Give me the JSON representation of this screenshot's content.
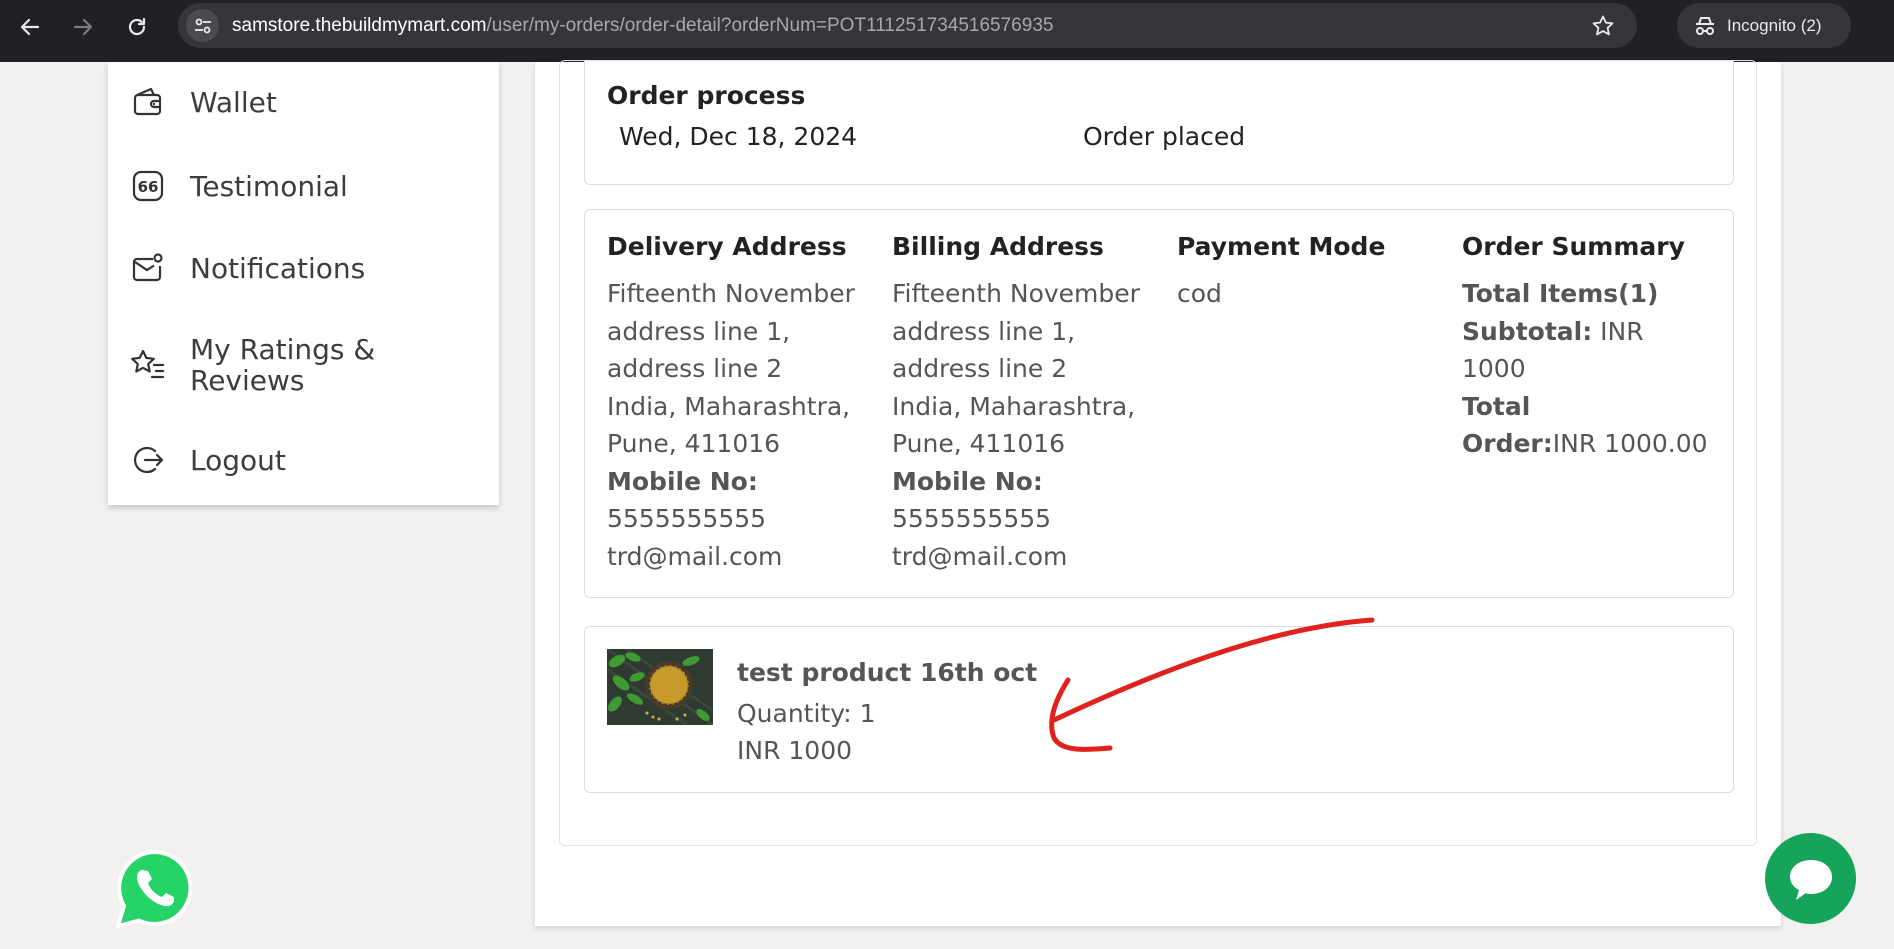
{
  "browser": {
    "url_host": "samstore.thebuildmymart.com",
    "url_path": "/user/my-orders/order-detail?orderNum=POT111251734516576935",
    "incognito_label": "Incognito (2)"
  },
  "sidebar": {
    "items": [
      {
        "label": "Wallet",
        "icon": "wallet-icon"
      },
      {
        "label": "Testimonial",
        "icon": "quote-icon"
      },
      {
        "label": "Notifications",
        "icon": "mail-notification-icon"
      },
      {
        "label": "My Ratings & Reviews",
        "icon": "star-rating-icon"
      },
      {
        "label": "Logout",
        "icon": "logout-icon"
      }
    ]
  },
  "order_process": {
    "title": "Order process",
    "date": "Wed, Dec 18, 2024",
    "status": "Order placed"
  },
  "delivery_address": {
    "title": "Delivery Address",
    "line1": "Fifteenth November",
    "line2": "address line 1,",
    "line3": "address line 2",
    "line4": "India, Maharashtra,",
    "line5": "Pune, 411016",
    "mobile_label": "Mobile No:",
    "mobile": "5555555555",
    "email": "trd@mail.com"
  },
  "billing_address": {
    "title": "Billing Address",
    "line1": "Fifteenth November",
    "line2": "address line 1,",
    "line3": "address line 2",
    "line4": "India, Maharashtra,",
    "line5": "Pune, 411016",
    "mobile_label": "Mobile No:",
    "mobile": "5555555555",
    "email": "trd@mail.com"
  },
  "payment": {
    "title": "Payment Mode",
    "mode": "cod"
  },
  "order_summary": {
    "title": "Order Summary",
    "total_items": "Total Items(1)",
    "subtotal_label": "Subtotal:",
    "subtotal_value": " INR 1000",
    "total_label_1": "Total",
    "total_label_2": "Order:",
    "total_value": "INR 1000.00"
  },
  "product": {
    "name": "test product 16th oct",
    "quantity": "Quantity: 1",
    "price": "INR 1000"
  },
  "colors": {
    "chrome_bg": "#202124",
    "omnibox_bg": "#35363a",
    "whatsapp_green": "#25d366",
    "chat_green": "#16a35a",
    "annotation_red": "#e0211d"
  }
}
